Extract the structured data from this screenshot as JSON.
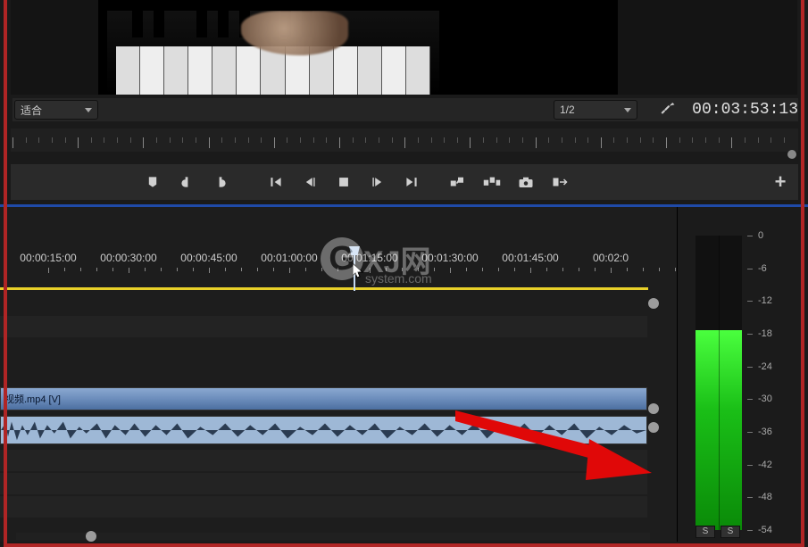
{
  "preview": {
    "alt": "piano-video-frame"
  },
  "controls": {
    "zoom_select": "适合",
    "quality_select": "1/2",
    "timecode": "00:03:53:13"
  },
  "transport": {
    "marker": "add-marker",
    "in": "mark-in",
    "out": "mark-out",
    "go_in": "go-to-in",
    "step_back": "step-back",
    "play_stop": "stop",
    "step_fwd": "step-forward",
    "go_out": "go-to-out",
    "lift": "lift",
    "extract": "extract",
    "snap": "export-frame",
    "insert": "insert",
    "add": "+"
  },
  "timeline": {
    "labels": [
      "00:00:15:00",
      "00:00:30:00",
      "00:00:45:00",
      "00:01:00:00",
      "00:01:15:00",
      "00:01:30:00",
      "00:01:45:00",
      "00:02:0"
    ],
    "playhead": "00:01:15:00",
    "video_clip_label": "视频.mp4 [V]"
  },
  "watermark": {
    "g": "G",
    "title": "XJ网",
    "sub": "system.com"
  },
  "meters": {
    "scale": [
      "0",
      "-6",
      "-12",
      "-18",
      "-24",
      "-30",
      "-36",
      "-42",
      "-48",
      "-54"
    ],
    "solo": "S"
  }
}
